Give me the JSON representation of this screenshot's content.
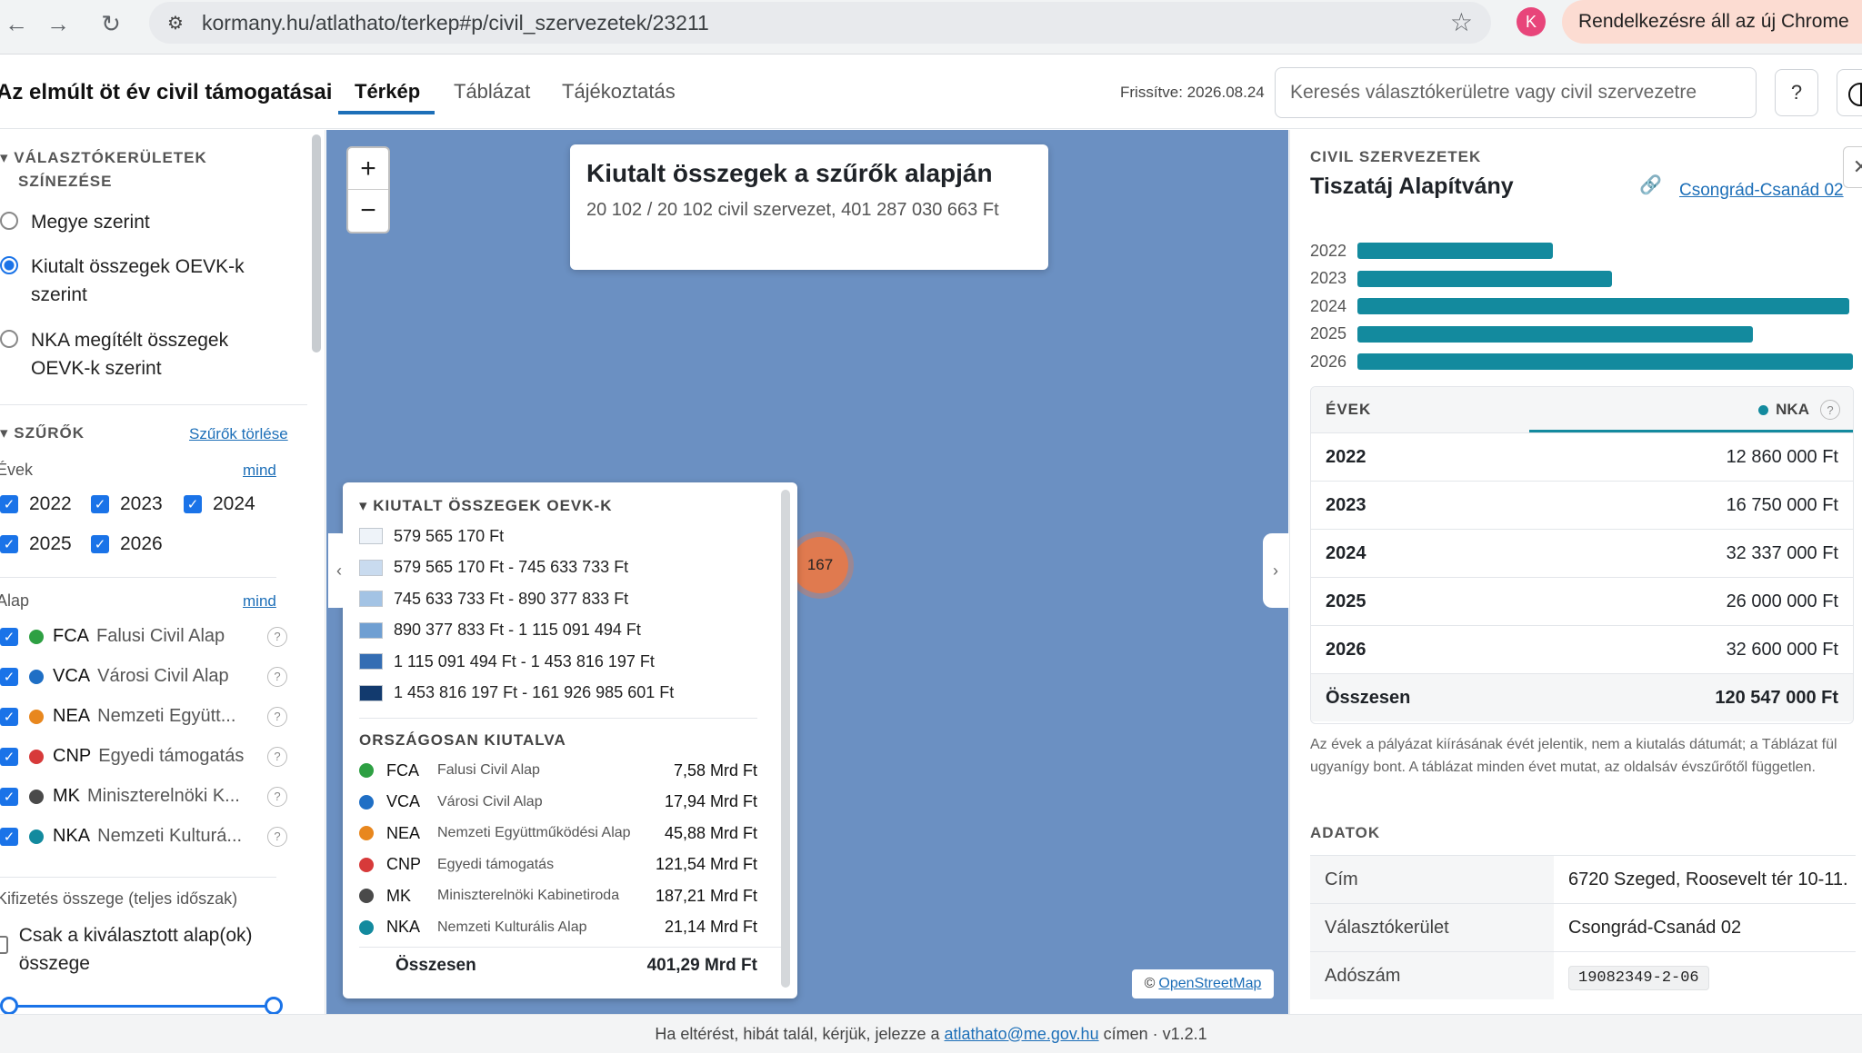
{
  "browser": {
    "url": "kormany.hu/atlathato/terkep#p/civil_szervezetek/23211",
    "profile_initial": "K",
    "update_notice": "Rendelkezésre áll az új Chrome"
  },
  "header": {
    "title": "Az elmúlt öt év civil támogatásai",
    "tabs": [
      {
        "label": "Térkép",
        "active": true
      },
      {
        "label": "Táblázat",
        "active": false
      },
      {
        "label": "Tájékoztatás",
        "active": false
      }
    ],
    "updated": "Frissítve: 2026.08.24",
    "search_placeholder": "Keresés választókerületre vagy civil szervezetre",
    "help_label": "?"
  },
  "sidebar": {
    "coloring": {
      "title_line1": "VÁLASZTÓKERÜLETEK",
      "title_line2": "SZÍNEZÉSE",
      "options": [
        {
          "label": "Megye szerint",
          "selected": false
        },
        {
          "label": "Kiutalt összegek OEVK-k szerint",
          "selected": true
        },
        {
          "label": "NKA megítélt összegek OEVK-k szerint",
          "selected": false
        }
      ]
    },
    "filters": {
      "title": "SZŰRŐK",
      "clear_label": "Szűrők törlése",
      "years_label": "Évek",
      "all_label": "mind",
      "years": [
        "2022",
        "2023",
        "2024",
        "2025",
        "2026"
      ],
      "fund_label": "Alap",
      "funds": [
        {
          "code": "FCA",
          "name": "Falusi Civil Alap",
          "color": "#2ea043"
        },
        {
          "code": "VCA",
          "name": "Városi Civil Alap",
          "color": "#1f6fc5"
        },
        {
          "code": "NEA",
          "name": "Nemzeti Együtt...",
          "color": "#e8871e"
        },
        {
          "code": "CNP",
          "name": "Egyedi támogatás",
          "color": "#d73a3a"
        },
        {
          "code": "MK",
          "name": "Miniszterelnöki K...",
          "color": "#4a4a4a"
        },
        {
          "code": "NKA",
          "name": "Nemzeti Kulturá...",
          "color": "#138a9e"
        }
      ],
      "payment_label": "Kifizetés összege (teljes időszak)",
      "only_selected_label": "Csak a kiválasztott alap(ok) összege"
    }
  },
  "map": {
    "zoom_in": "+",
    "zoom_out": "−",
    "info_title": "Kiutalt összegek a szűrők alapján",
    "info_sub": "20 102 / 20 102 civil szervezet, 401 287 030 663 Ft",
    "cluster_label": "167",
    "attribution_prefix": "©",
    "attribution_link": "OpenStreetMap",
    "legend": {
      "title": "KIUTALT ÖSSZEGEK OEVK-K",
      "ranges": [
        {
          "label": "579 565 170 Ft",
          "color": "#eef3f9"
        },
        {
          "label": "579 565 170 Ft - 745 633 733 Ft",
          "color": "#c9dbef"
        },
        {
          "label": "745 633 733 Ft - 890 377 833 Ft",
          "color": "#a3c3e4"
        },
        {
          "label": "890 377 833 Ft - 1 115 091 494 Ft",
          "color": "#6f9fd2"
        },
        {
          "label": "1 115 091 494 Ft - 1 453 816 197 Ft",
          "color": "#346db3"
        },
        {
          "label": "1 453 816 197 Ft - 161 926 985 601 Ft",
          "color": "#123a6e"
        }
      ],
      "national_title": "ORSZÁGOSAN KIUTALVA",
      "national": [
        {
          "code": "FCA",
          "name": "Falusi Civil Alap",
          "value": "7,58 Mrd Ft",
          "color": "#2ea043"
        },
        {
          "code": "VCA",
          "name": "Városi Civil Alap",
          "value": "17,94 Mrd Ft",
          "color": "#1f6fc5"
        },
        {
          "code": "NEA",
          "name": "Nemzeti Együttműködési Alap",
          "value": "45,88 Mrd Ft",
          "color": "#e8871e"
        },
        {
          "code": "CNP",
          "name": "Egyedi támogatás",
          "value": "121,54 Mrd Ft",
          "color": "#d73a3a"
        },
        {
          "code": "MK",
          "name": "Miniszterelnöki Kabinetiroda",
          "value": "187,21 Mrd Ft",
          "color": "#4a4a4a"
        },
        {
          "code": "NKA",
          "name": "Nemzeti Kulturális Alap",
          "value": "21,14 Mrd Ft",
          "color": "#138a9e"
        }
      ],
      "total_label": "Összesen",
      "total_value": "401,29 Mrd Ft"
    }
  },
  "panel": {
    "eyebrow": "CIVIL SZERVEZETEK",
    "title": "Tiszatáj Alapítvány",
    "district": "Csongrád-Csanád 02",
    "yearly_bars": [
      {
        "year": "2022",
        "value": 12860000
      },
      {
        "year": "2023",
        "value": 16750000
      },
      {
        "year": "2024",
        "value": 32337000
      },
      {
        "year": "2025",
        "value": 26000000
      },
      {
        "year": "2026",
        "value": 32600000
      }
    ],
    "table_head_years": "ÉVEK",
    "table_head_fund": "NKA",
    "table_rows": [
      {
        "year": "2022",
        "amount": "12 860 000 Ft"
      },
      {
        "year": "2023",
        "amount": "16 750 000 Ft"
      },
      {
        "year": "2024",
        "amount": "32 337 000 Ft"
      },
      {
        "year": "2025",
        "amount": "26 000 000 Ft"
      },
      {
        "year": "2026",
        "amount": "32 600 000 Ft"
      }
    ],
    "total_label": "Összesen",
    "total_amount": "120 547 000 Ft",
    "note": "Az évek a pályázat kiírásának évét jelentik, nem a kiutalás dátumát; a Táblázat fül ugyanígy bont. A táblázat minden évet mutat, az oldalsáv évszűrőtől független.",
    "data_title": "ADATOK",
    "data_rows": [
      {
        "key": "Cím",
        "value": "6720 Szeged, Roosevelt tér 10-11."
      },
      {
        "key": "Választókerület",
        "value": "Csongrád-Csanád 02"
      },
      {
        "key": "Adószám",
        "value": "19082349-2-06"
      }
    ]
  },
  "footer": {
    "prefix": "Ha eltérést, hibát talál, kérjük, jelezze a",
    "email": "atlathato@me.gov.hu",
    "suffix": "címen · v1.2.1"
  }
}
